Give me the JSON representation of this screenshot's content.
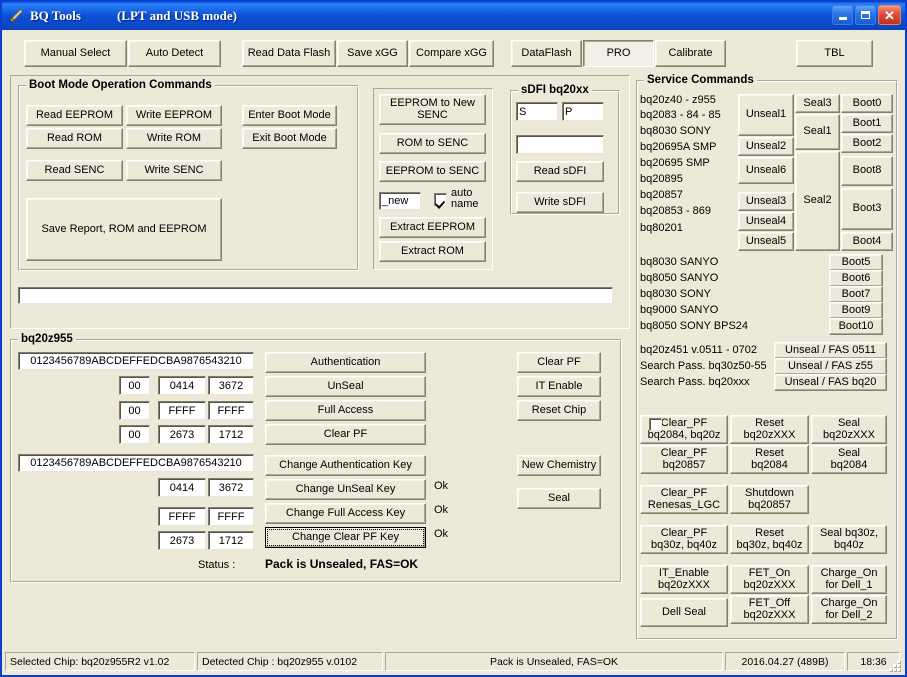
{
  "window": {
    "title": "BQ Tools",
    "subtitle": "(LPT and USB mode)",
    "icon": "wrench-icon",
    "minimize": "minimize-icon",
    "maximize": "maximize-icon",
    "close": "close-icon"
  },
  "toolbar": {
    "manual_select": "Manual Select",
    "auto_detect": "Auto Detect",
    "read_data_flash": "Read Data Flash",
    "save_xgg": "Save xGG",
    "compare_xgg": "Compare xGG",
    "dataflash": "DataFlash",
    "pro": "PRO",
    "calibrate": "Calibrate",
    "tbl": "TBL"
  },
  "boot_mode": {
    "title": "Boot Mode Operation Commands",
    "read_eeprom": "Read EEPROM",
    "write_eeprom": "Write EEPROM",
    "enter_boot_mode": "Enter Boot Mode",
    "read_rom": "Read ROM",
    "write_rom": "Write ROM",
    "exit_boot_mode": "Exit  Boot Mode",
    "read_senc": "Read SENC",
    "write_senc": "Write SENC",
    "save_report": "Save Report,  ROM and EEPROM",
    "log_field": ""
  },
  "senc": {
    "eeprom_to_new_senc": "EEPROM  to  New\nSENC",
    "rom_to_senc": "ROM  to  SENC",
    "eeprom_to_senc": "EEPROM  to  SENC",
    "name_value": "_new",
    "auto_name_label": "auto\nname",
    "auto_name_checked": true,
    "extract_eeprom": "Extract EEPROM",
    "extract_rom": "Extract ROM"
  },
  "sdfi": {
    "title": "sDFI bq20xx",
    "s_value": "S",
    "p_value": "P",
    "data_value": "",
    "read": "Read sDFI",
    "write": "Write sDFI"
  },
  "service": {
    "title": "Service Commands",
    "chips": [
      "bq20z40 - z955",
      "bq2083 - 84 - 85",
      "bq8030    SONY",
      "bq20695A  SMP",
      "bq20695    SMP",
      "bq20895",
      "bq20857",
      "bq20853 - 869",
      "bq80201"
    ],
    "chips2": [
      "bq8030    SANYO",
      "bq8050    SANYO",
      "bq8030    SONY",
      "bq9000    SANYO",
      "bq8050    SONY   BPS24"
    ],
    "unseal1": "Unseal1",
    "unseal2": "Unseal2",
    "unseal6": "Unseal6",
    "unseal3": "Unseal3",
    "unseal4": "Unseal4",
    "unseal5": "Unseal5",
    "seal3": "Seal3",
    "seal1": "Seal1",
    "seal2": "Seal2",
    "boot0": "Boot0",
    "boot1": "Boot1",
    "boot2": "Boot2",
    "boot8": "Boot8",
    "boot3": "Boot3",
    "boot4": "Boot4",
    "boot5": "Boot5",
    "boot6": "Boot6",
    "boot7": "Boot7",
    "boot9": "Boot9",
    "boot10": "Boot10",
    "pass_labels": [
      "bq20z451 v.0511 - 0702",
      "Search Pass.  bq30z50-55",
      "Search Pass.  bq20xxx"
    ],
    "unseal_fas_0511": "Unseal / FAS 0511",
    "unseal_fas_z55": "Unseal / FAS  z55",
    "unseal_fas_bq20": "Unseal / FAS bq20"
  },
  "service_grid": {
    "clear_pf_bq2084": "Clear_PF\nbq2084, bq20z",
    "clear_pf_bq2084_checked": false,
    "reset_bq20zxxx": "Reset\nbq20zXXX",
    "seal_bq20zxxx": "Seal\nbq20zXXX",
    "clear_pf_bq20857": "Clear_PF\nbq20857",
    "reset_bq2084": "Reset\nbq2084",
    "seal_bq2084": "Seal\nbq2084",
    "clear_pf_renesas": "Clear_PF\nRenesas_LGC",
    "shutdown_bq20857": "Shutdown\nbq20857",
    "clear_pf_bq30z": "Clear_PF\nbq30z, bq40z",
    "reset_bq30z": "Reset\nbq30z, bq40z",
    "seal_bq30z": "Seal bq30z,\nbq40z",
    "it_enable": "IT_Enable\nbq20zXXX",
    "fet_on": "FET_On\nbq20zXXX",
    "charge_on_dell1": "Charge_On\nfor Dell_1",
    "dell_seal": "Dell Seal",
    "fet_off": "FET_Off\nbq20zXXX",
    "charge_on_dell2": "Charge_On\nfor Dell_2"
  },
  "chip_panel": {
    "title": "bq20z955",
    "key1": "0123456789ABCDEFFEDCBA9876543210",
    "rows1": [
      {
        "a": "00",
        "b": "0414",
        "c": "3672"
      },
      {
        "a": "00",
        "b": "FFFF",
        "c": "FFFF"
      },
      {
        "a": "00",
        "b": "2673",
        "c": "1712"
      }
    ],
    "key2": "0123456789ABCDEFFEDCBA9876543210",
    "rows2": [
      {
        "b": "0414",
        "c": "3672"
      },
      {
        "b": "FFFF",
        "c": "FFFF"
      },
      {
        "b": "2673",
        "c": "1712"
      }
    ],
    "authentication": "Authentication",
    "unseal": "UnSeal",
    "full_access": "Full Access",
    "clear_pf": "Clear PF",
    "change_auth_key": "Change Authentication Key",
    "change_unseal_key": "Change UnSeal Key",
    "change_full_access_key": "Change Full Access Key",
    "change_clear_pf_key": "Change Clear PF Key",
    "ok1": "Ok",
    "ok2": "Ok",
    "ok3": "Ok",
    "clear_pf_right": "Clear PF",
    "it_enable_right": "IT Enable",
    "reset_chip": "Reset Chip",
    "new_chemistry": "New Chemistry",
    "seal": "Seal",
    "status_label": "Status :",
    "status_value": "Pack is Unsealed, FAS=OK"
  },
  "statusbar": {
    "selected_chip": "Selected Chip: bq20z955R2 v1.02",
    "detected_chip": "Detected Chip : bq20z955  v.0102",
    "pack_status": "Pack is Unsealed, FAS=OK",
    "date": "2016.04.27  (489B)",
    "time": "18:36"
  }
}
